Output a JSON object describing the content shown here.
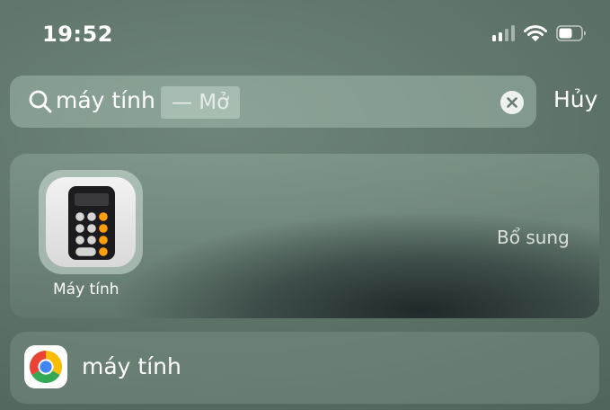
{
  "status_bar": {
    "time": "19:52",
    "icons": [
      "cellular-signal-icon",
      "wifi-icon",
      "battery-icon"
    ]
  },
  "search": {
    "query": "máy tính",
    "suggestion": "— Mở",
    "clear_icon": "clear-icon",
    "cancel_label": "Hủy"
  },
  "top_hit": {
    "app_name": "Máy tính",
    "icon": "calculator-app-icon",
    "more_label": "Bổ sung"
  },
  "results": [
    {
      "label": "máy tính",
      "icon": "chrome-icon"
    }
  ],
  "colors": {
    "calculator_dark": "#1c1c1e",
    "calculator_gray": "#d4d4d2",
    "calculator_orange": "#ff9f0a"
  }
}
